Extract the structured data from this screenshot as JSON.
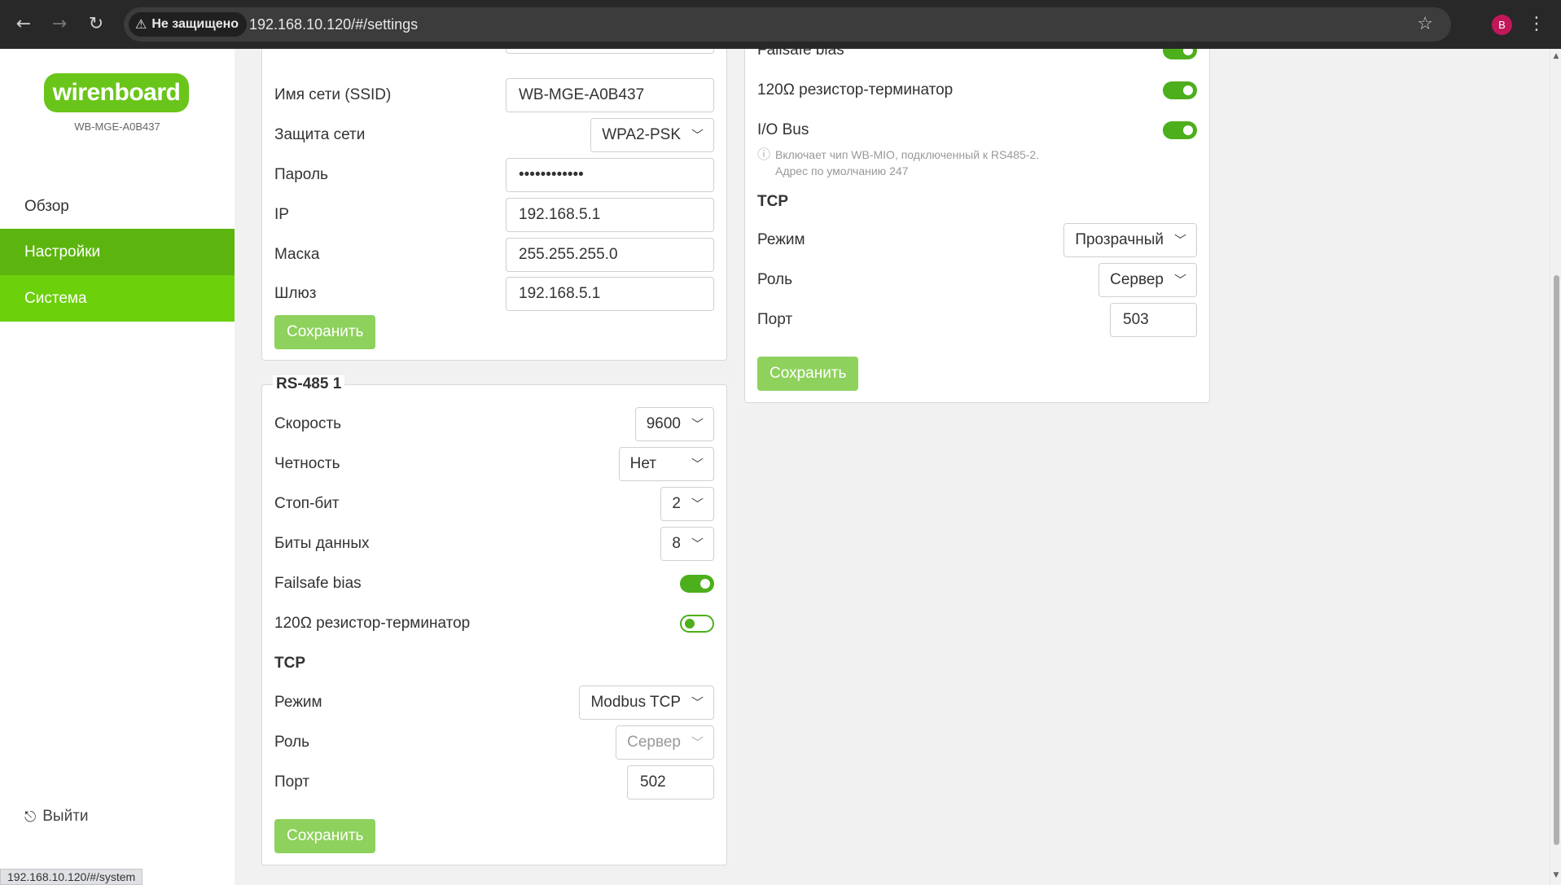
{
  "browser": {
    "back_icon": "←",
    "forward_icon": "→",
    "reload_icon": "↻",
    "security_label": "Не защищено",
    "warning_icon": "⚠",
    "url": "192.168.10.120/#/settings",
    "star_icon": "☆",
    "profile_initial": "B",
    "menu_icon": "⋮"
  },
  "sidebar": {
    "logo": "wirenboard",
    "device_id": "WB-MGE-A0B437",
    "items": [
      {
        "label": "Обзор"
      },
      {
        "label": "Настройки"
      },
      {
        "label": "Система"
      }
    ],
    "logout_label": "Выйти",
    "logout_icon": "⎋"
  },
  "status_bar": {
    "url": "192.168.10.120/#/system"
  },
  "wifi": {
    "ssid_label": "Имя сети (SSID)",
    "ssid_value": "WB-MGE-A0B437",
    "security_label": "Защита сети",
    "security_value": "WPA2-PSK",
    "password_label": "Пароль",
    "password_value": "••••••••••••",
    "ip_label": "IP",
    "ip_value": "192.168.5.1",
    "mask_label": "Маска",
    "mask_value": "255.255.255.0",
    "gateway_label": "Шлюз",
    "gateway_value": "192.168.5.1",
    "save_label": "Сохранить"
  },
  "rs485_1": {
    "title": "RS-485 1",
    "speed_label": "Скорость",
    "speed_value": "9600",
    "parity_label": "Четность",
    "parity_value": "Нет",
    "stopbits_label": "Стоп-бит",
    "stopbits_value": "2",
    "databits_label": "Биты данных",
    "databits_value": "8",
    "failsafe_label": "Failsafe bias",
    "terminator_label": "120Ω резистор-терминатор",
    "tcp_heading": "TCP",
    "mode_label": "Режим",
    "mode_value": "Modbus TCP",
    "role_label": "Роль",
    "role_value": "Сервер",
    "port_label": "Порт",
    "port_value": "502",
    "save_label": "Сохранить"
  },
  "rs485_2": {
    "failsafe_label": "Failsafe bias",
    "terminator_label": "120Ω резистор-терминатор",
    "iobus_label": "I/O Bus",
    "iobus_hint_line1": "Включает чип WB-MIO, подключенный к RS485-2.",
    "iobus_hint_line2": "Адрес по умолчанию 247",
    "info_icon": "ⓘ",
    "tcp_heading": "TCP",
    "mode_label": "Режим",
    "mode_value": "Прозрачный",
    "role_label": "Роль",
    "role_value": "Сервер",
    "port_label": "Порт",
    "port_value": "503",
    "save_label": "Сохранить"
  },
  "chevron": "﹀"
}
